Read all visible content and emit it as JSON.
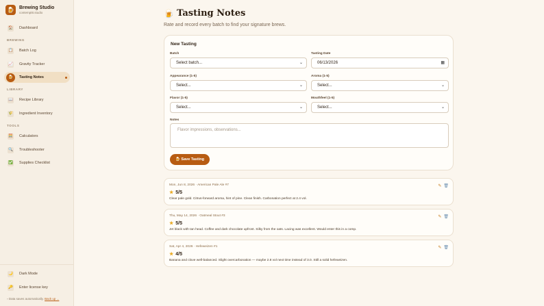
{
  "brand": {
    "title": "Brewing Studio",
    "subtitle": "contempt8.studio",
    "logo": "🍺"
  },
  "nav": {
    "dashboard": {
      "label": "Dashboard",
      "icon": "🏠"
    },
    "sections": {
      "brewing": "BREWING",
      "library": "LIBRARY",
      "tools": "TOOLS"
    },
    "batch_log": {
      "label": "Batch Log",
      "icon": "📋"
    },
    "gravity": {
      "label": "Gravity Tracker",
      "icon": "📈"
    },
    "tasting": {
      "label": "Tasting Notes",
      "icon": "🍺"
    },
    "recipe": {
      "label": "Recipe Library",
      "icon": "📖"
    },
    "ingredient": {
      "label": "Ingredient Inventory",
      "icon": "🌾"
    },
    "calculators": {
      "label": "Calculators",
      "icon": "🧮"
    },
    "troubleshooter": {
      "label": "Troubleshooter",
      "icon": "🔍"
    },
    "supplies": {
      "label": "Supplies Checklist",
      "icon": "✅"
    },
    "dark_mode": {
      "label": "Dark Mode",
      "icon": "🌙"
    },
    "license": {
      "label": "Enter license key",
      "icon": "🔑"
    }
  },
  "autosave": {
    "text": "Data saves automatically.",
    "link": "Back up ..."
  },
  "page": {
    "title": "Tasting Notes",
    "icon": "🍺",
    "subtitle": "Rate and record every batch to find your signature brews."
  },
  "form": {
    "title": "New Tasting",
    "batch_label": "Batch",
    "batch_value": "Select batch...",
    "date_label": "Tasting Date",
    "date_value": "06/13/2026",
    "appearance_label": "Appearance (1-5)",
    "appearance_value": "Select...",
    "aroma_label": "Aroma (1-5)",
    "aroma_value": "Select...",
    "flavor_label": "Flavor (1-5)",
    "flavor_value": "Select...",
    "mouthfeel_label": "Mouthfeel (1-5)",
    "mouthfeel_value": "Select...",
    "notes_label": "Notes",
    "notes_placeholder": "Flavor impressions, observations...",
    "save_label": "🍺 Save Tasting"
  },
  "entries": [
    {
      "meta": "Mon, Jun 8, 2026 · American Pale Ale #7",
      "rating": "5/5",
      "note": "Clear pale gold. Citrus-forward aroma, hint of pine. Clean finish. Carbonation perfect at 2.4 vol."
    },
    {
      "meta": "Thu, May 14, 2026 · Oatmeal Stout #3",
      "rating": "5/5",
      "note": "Jet black with tan head. Coffee and dark chocolate upfront. Silky from the oats. Lacing was excellent. Would enter this in a comp."
    },
    {
      "meta": "Sat, Apr 4, 2026 · Hefeweizen #1",
      "rating": "4/5",
      "note": "Banana and clove well-balanced. Slight overcarbonation — maybe 2.8 vol next time instead of 3.0. Still a solid hefeweizen."
    }
  ],
  "colors": {
    "accent": "#b85c12",
    "background": "#fbf6ee",
    "sidebar": "#f6efe4"
  }
}
